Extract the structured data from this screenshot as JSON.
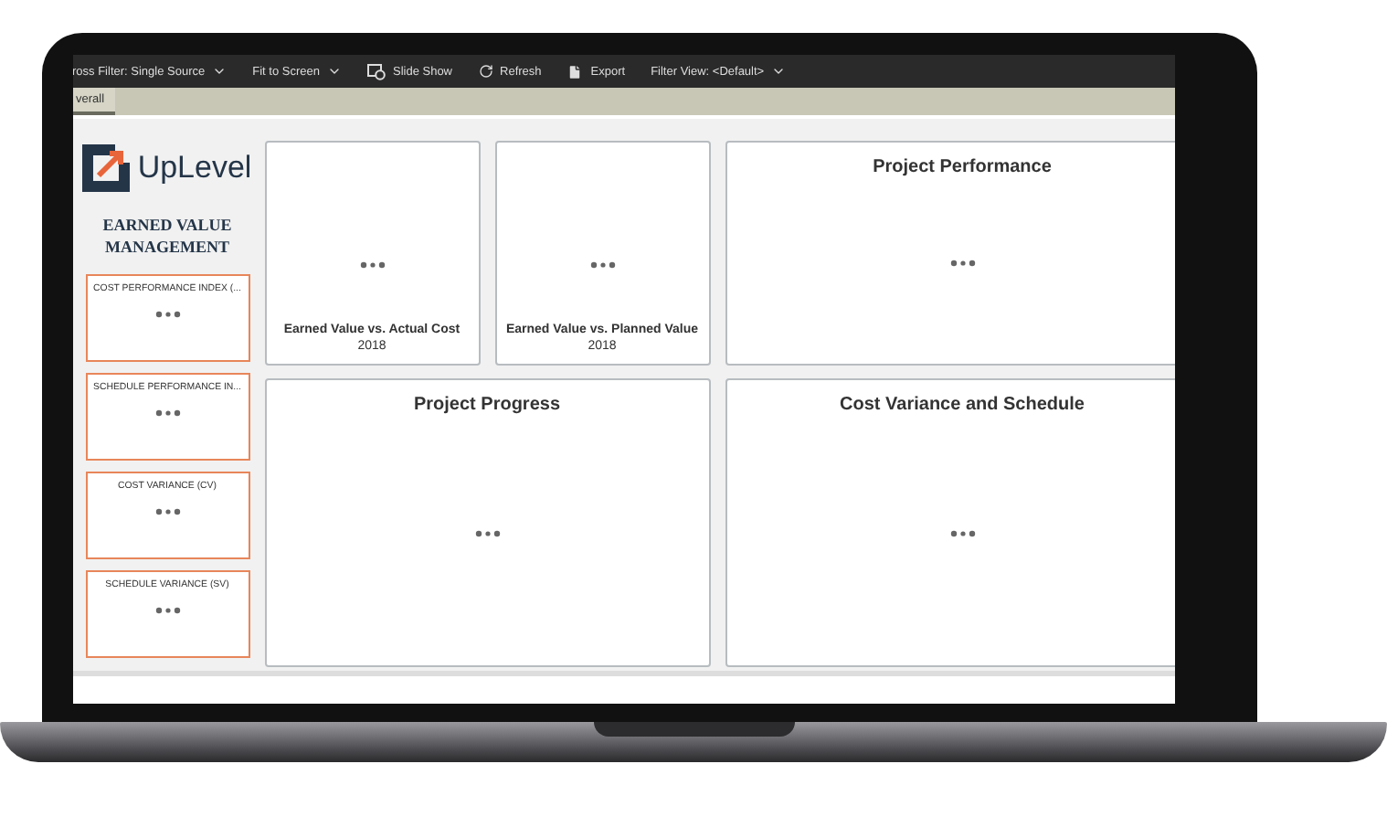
{
  "toolbar": {
    "items": [
      {
        "label": "ross Filter: Single Source",
        "kind": "dropdown"
      },
      {
        "label": "Fit to Screen",
        "kind": "dropdown"
      },
      {
        "label": "Slide Show",
        "kind": "slideshow"
      },
      {
        "label": "Refresh",
        "kind": "refresh"
      },
      {
        "label": "Export",
        "kind": "export"
      },
      {
        "label": "Filter View: <Default>",
        "kind": "dropdown"
      }
    ]
  },
  "tabs": [
    {
      "label": "verall",
      "selected": true
    }
  ],
  "brand": {
    "name": "UpLevel"
  },
  "sidebar": {
    "title": "EARNED VALUE MANAGEMENT",
    "kpis": [
      {
        "label": "COST PERFORMANCE INDEX (..."
      },
      {
        "label": "SCHEDULE PERFORMANCE IN..."
      },
      {
        "label": "COST VARIANCE (CV)"
      },
      {
        "label": "SCHEDULE VARIANCE (SV)"
      }
    ]
  },
  "panels": [
    {
      "title": "Earned Value vs. Actual Cost",
      "subtitle": "2018",
      "kind": "footer"
    },
    {
      "title": "Earned Value vs. Planned Value",
      "subtitle": "2018",
      "kind": "footer"
    },
    {
      "title": "Project Performance",
      "kind": "header"
    },
    {
      "title": "Project Progress",
      "kind": "header"
    },
    {
      "title": "Cost Variance and Schedule",
      "kind": "header"
    }
  ]
}
